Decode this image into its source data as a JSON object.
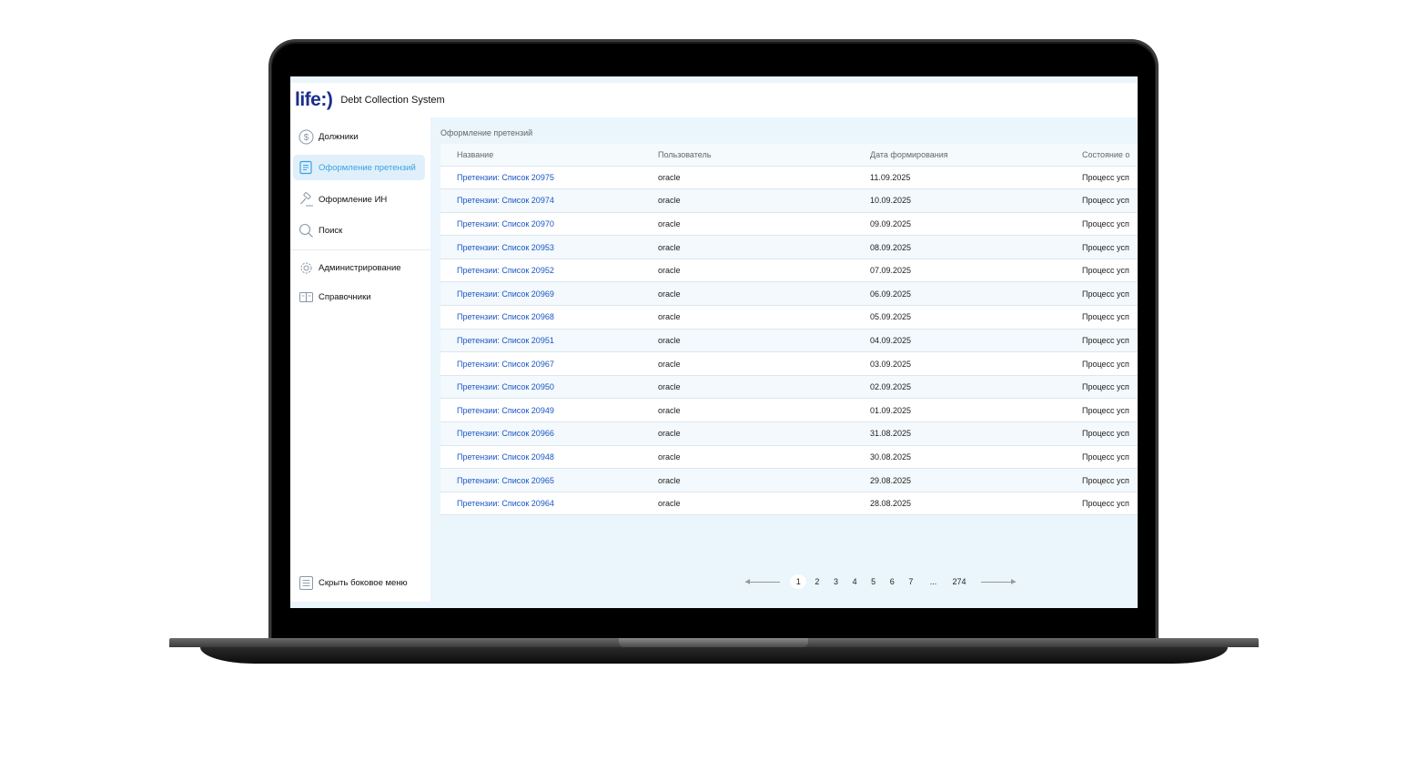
{
  "app": {
    "logo": "life:)",
    "title": "Debt Collection System"
  },
  "sidebar": {
    "items": [
      {
        "label": "Должники",
        "icon": "dollar-icon"
      },
      {
        "label": "Оформление претензий",
        "icon": "document-icon",
        "active": true
      },
      {
        "label": "Оформление ИН",
        "icon": "gavel-icon"
      },
      {
        "label": "Поиск",
        "icon": "search-icon"
      },
      {
        "label": "Администрирование",
        "icon": "gear-icon"
      },
      {
        "label": "Справочники",
        "icon": "book-icon"
      }
    ],
    "hide_label": "Скрыть боковое меню"
  },
  "main": {
    "title": "Оформление претензий",
    "columns": [
      "Название",
      "Пользователь",
      "Дата формирования",
      "Состояние о"
    ],
    "rows": [
      [
        "Претензии: Список 20975",
        "oracle",
        "11.09.2025",
        "Процесс усп"
      ],
      [
        "Претензии: Список 20974",
        "oracle",
        "10.09.2025",
        "Процесс усп"
      ],
      [
        "Претензии: Список 20970",
        "oracle",
        "09.09.2025",
        "Процесс усп"
      ],
      [
        "Претензии: Список 20953",
        "oracle",
        "08.09.2025",
        "Процесс усп"
      ],
      [
        "Претензии: Список 20952",
        "oracle",
        "07.09.2025",
        "Процесс усп"
      ],
      [
        "Претензии: Список 20969",
        "oracle",
        "06.09.2025",
        "Процесс усп"
      ],
      [
        "Претензии: Список 20968",
        "oracle",
        "05.09.2025",
        "Процесс усп"
      ],
      [
        "Претензии: Список 20951",
        "oracle",
        "04.09.2025",
        "Процесс усп"
      ],
      [
        "Претензии: Список 20967",
        "oracle",
        "03.09.2025",
        "Процесс усп"
      ],
      [
        "Претензии: Список 20950",
        "oracle",
        "02.09.2025",
        "Процесс усп"
      ],
      [
        "Претензии: Список 20949",
        "oracle",
        "01.09.2025",
        "Процесс усп"
      ],
      [
        "Претензии: Список 20966",
        "oracle",
        "31.08.2025",
        "Процесс усп"
      ],
      [
        "Претензии: Список 20948",
        "oracle",
        "30.08.2025",
        "Процесс усп"
      ],
      [
        "Претензии: Список 20965",
        "oracle",
        "29.08.2025",
        "Процесс усп"
      ],
      [
        "Претензии: Список 20964",
        "oracle",
        "28.08.2025",
        "Процесс усп"
      ]
    ]
  },
  "pagination": {
    "pages": [
      "1",
      "2",
      "3",
      "4",
      "5",
      "6",
      "7",
      "...",
      "274"
    ],
    "current": "1"
  },
  "colors": {
    "brand": "#1a2d8c",
    "link": "#1a55c4",
    "active": "#3aa0e0",
    "background": "#eaf5fc"
  }
}
